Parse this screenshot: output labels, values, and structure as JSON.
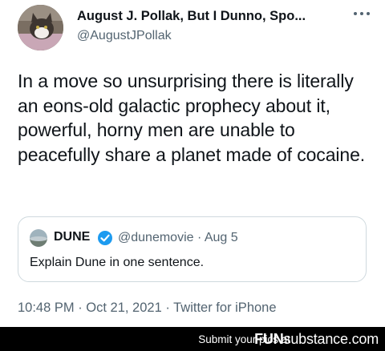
{
  "tweet": {
    "author": {
      "display_name": "August J. Pollak, But I Dunno, Spo...",
      "handle": "@AugustJPollak"
    },
    "text": "In a move so unsurprising there is literally an eons-old galactic prophecy about it, powerful, horny men are unable to peacefully share a planet made of cocaine.",
    "more_icon": "ellipsis-icon",
    "quoted": {
      "name": "DUNE",
      "verified_icon": "verified-badge-icon",
      "handle_date": "@dunemovie · Aug 5",
      "text": "Explain Dune in one sentence."
    },
    "meta": "10:48 PM · Oct 21, 2021 · Twitter for iPhone"
  },
  "footer": {
    "text": "Submit your pics at",
    "logo_bold": "FUN",
    "logo_rest": "substance.com"
  },
  "colors": {
    "secondary_text": "#536471",
    "primary_text": "#0f1419",
    "verified_blue": "#1d9bf0",
    "border": "#cfd9de",
    "footer_bg": "#000000"
  }
}
